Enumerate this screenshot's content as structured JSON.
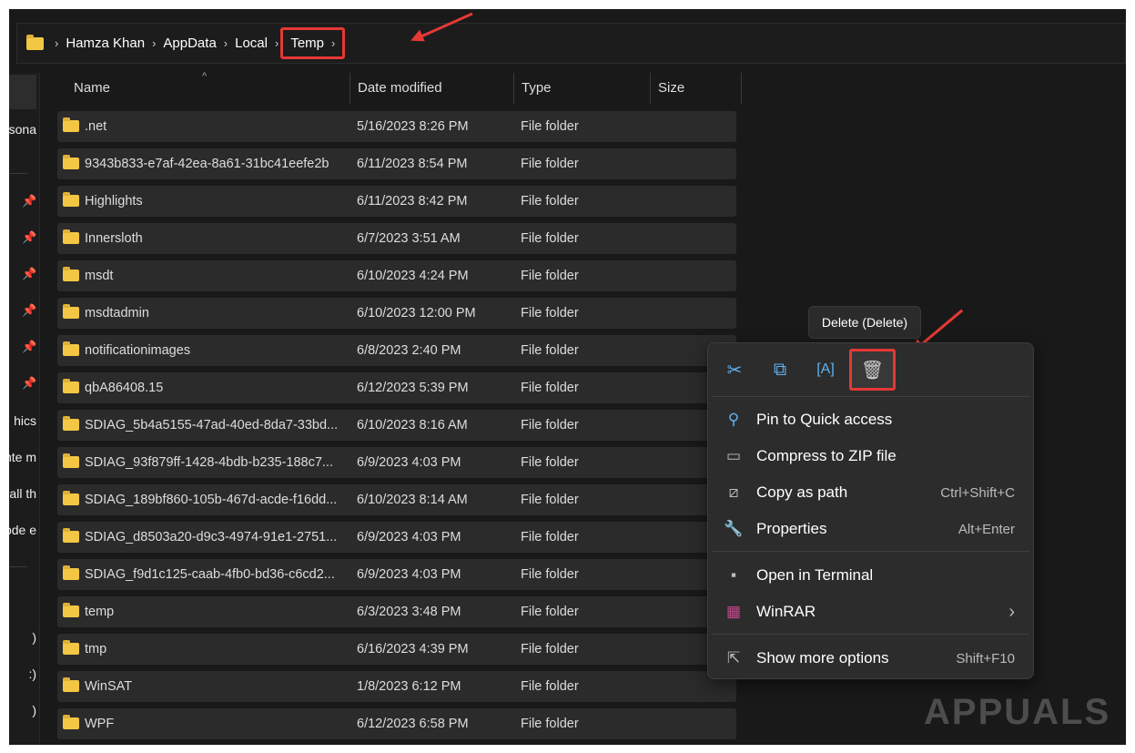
{
  "breadcrumb": [
    "Hamza Khan",
    "AppData",
    "Local",
    "Temp"
  ],
  "sidebar": {
    "texts": [
      "sona",
      "hics",
      "nte m",
      "all th",
      "ode e",
      ")",
      ":)",
      ")"
    ]
  },
  "columns": [
    "Name",
    "Date modified",
    "Type",
    "Size"
  ],
  "files": [
    {
      "name": ".net",
      "date": "5/16/2023 8:26 PM",
      "type": "File folder"
    },
    {
      "name": "9343b833-e7af-42ea-8a61-31bc41eefe2b",
      "date": "6/11/2023 8:54 PM",
      "type": "File folder"
    },
    {
      "name": "Highlights",
      "date": "6/11/2023 8:42 PM",
      "type": "File folder"
    },
    {
      "name": "Innersloth",
      "date": "6/7/2023 3:51 AM",
      "type": "File folder"
    },
    {
      "name": "msdt",
      "date": "6/10/2023 4:24 PM",
      "type": "File folder"
    },
    {
      "name": "msdtadmin",
      "date": "6/10/2023 12:00 PM",
      "type": "File folder"
    },
    {
      "name": "notificationimages",
      "date": "6/8/2023 2:40 PM",
      "type": "File folder"
    },
    {
      "name": "qbA86408.15",
      "date": "6/12/2023 5:39 PM",
      "type": "File folder"
    },
    {
      "name": "SDIAG_5b4a5155-47ad-40ed-8da7-33bd...",
      "date": "6/10/2023 8:16 AM",
      "type": "File folder"
    },
    {
      "name": "SDIAG_93f879ff-1428-4bdb-b235-188c7...",
      "date": "6/9/2023 4:03 PM",
      "type": "File folder"
    },
    {
      "name": "SDIAG_189bf860-105b-467d-acde-f16dd...",
      "date": "6/10/2023 8:14 AM",
      "type": "File folder"
    },
    {
      "name": "SDIAG_d8503a20-d9c3-4974-91e1-2751...",
      "date": "6/9/2023 4:03 PM",
      "type": "File folder"
    },
    {
      "name": "SDIAG_f9d1c125-caab-4fb0-bd36-c6cd2...",
      "date": "6/9/2023 4:03 PM",
      "type": "File folder"
    },
    {
      "name": "temp",
      "date": "6/3/2023 3:48 PM",
      "type": "File folder"
    },
    {
      "name": "tmp",
      "date": "6/16/2023 4:39 PM",
      "type": "File folder"
    },
    {
      "name": "WinSAT",
      "date": "1/8/2023 6:12 PM",
      "type": "File folder"
    },
    {
      "name": "WPF",
      "date": "6/12/2023 6:58 PM",
      "type": "File folder"
    }
  ],
  "tooltip": "Delete (Delete)",
  "context_menu": {
    "toolbar": [
      "cut",
      "copy",
      "rename",
      "delete"
    ],
    "items": [
      {
        "label": "Pin to Quick access",
        "shortcut": "",
        "icon": "pin-icon"
      },
      {
        "label": "Compress to ZIP file",
        "shortcut": "",
        "icon": "zip-icon"
      },
      {
        "label": "Copy as path",
        "shortcut": "Ctrl+Shift+C",
        "icon": "path-icon"
      },
      {
        "label": "Properties",
        "shortcut": "Alt+Enter",
        "icon": "wrench-icon"
      },
      {
        "label": "Open in Terminal",
        "shortcut": "",
        "icon": "terminal-icon"
      },
      {
        "label": "WinRAR",
        "shortcut": "",
        "icon": "winrar-icon"
      },
      {
        "label": "Show more options",
        "shortcut": "Shift+F10",
        "icon": "more-options-icon"
      }
    ]
  },
  "watermark": "APPUALS",
  "colors": {
    "highlight": "#e53935",
    "accent": "#5fb2f0",
    "folder": "#f3c744"
  }
}
